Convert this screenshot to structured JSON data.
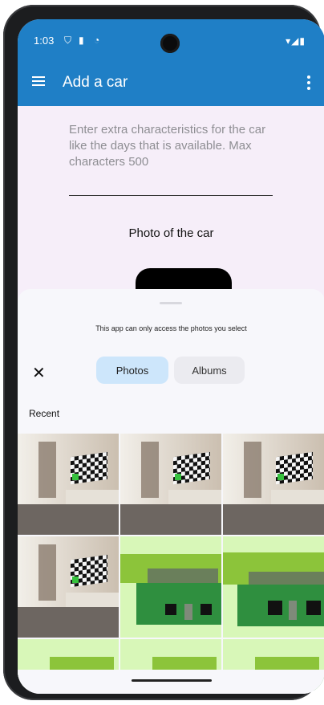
{
  "status": {
    "time": "1:03",
    "left_icons": [
      "shield-icon",
      "sd-card-icon",
      "sync-icon"
    ],
    "right_icons": [
      "wifi-icon",
      "signal-icon",
      "battery-icon"
    ]
  },
  "appbar": {
    "title": "Add a car",
    "menu_icon": "menu-icon",
    "more_icon": "more-vert-icon"
  },
  "form": {
    "hint_text": "Enter extra characteristics for the car like the days that is available. Max characters 500",
    "photo_label": "Photo of the car"
  },
  "picker": {
    "notice": "This app can only access the photos you select",
    "tabs": [
      {
        "label": "Photos",
        "selected": true
      },
      {
        "label": "Albums",
        "selected": false
      }
    ],
    "section_title": "Recent"
  },
  "colors": {
    "appbar": "#1f7fc6",
    "selected_tab": "#cde6fb",
    "sheet": "#f7f7fb"
  }
}
